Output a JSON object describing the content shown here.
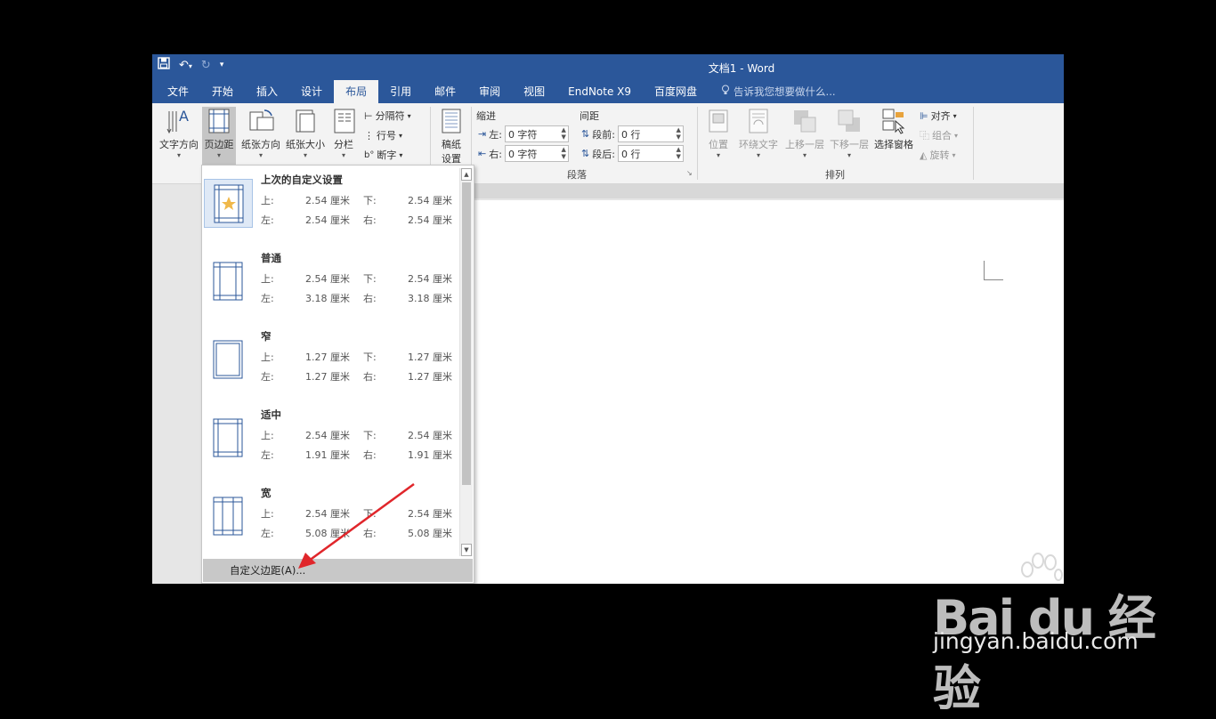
{
  "window": {
    "title": "文档1 - Word"
  },
  "tabs": [
    {
      "label": "文件"
    },
    {
      "label": "开始"
    },
    {
      "label": "插入"
    },
    {
      "label": "设计"
    },
    {
      "label": "布局",
      "active": true
    },
    {
      "label": "引用"
    },
    {
      "label": "邮件"
    },
    {
      "label": "审阅"
    },
    {
      "label": "视图"
    },
    {
      "label": "EndNote X9"
    },
    {
      "label": "百度网盘"
    }
  ],
  "tell_me": "告诉我您想要做什么...",
  "ribbon": {
    "text_direction": "文字方向",
    "margins": "页边距",
    "orientation": "纸张方向",
    "size": "纸张大小",
    "columns": "分栏",
    "breaks": "分隔符",
    "line_numbers": "行号",
    "hyphenation": "断字",
    "manuscript": "稿纸",
    "manuscript2": "设置",
    "indent_label": "缩进",
    "spacing_label": "间距",
    "indent_left_label": "左:",
    "indent_left_value": "0 字符",
    "indent_right_label": "右:",
    "indent_right_value": "0 字符",
    "before_label": "段前:",
    "before_value": "0 行",
    "after_label": "段后:",
    "after_value": "0 行",
    "paragraph_group": "段落",
    "position": "位置",
    "wrap_text": "环绕文字",
    "bring_forward": "上移一层",
    "send_backward": "下移一层",
    "selection_pane": "选择窗格",
    "align": "对齐",
    "group": "组合",
    "rotate": "旋转",
    "arrange_group": "排列"
  },
  "margins_menu": {
    "items": [
      {
        "title": "上次的自定义设置",
        "top_label": "上:",
        "top": "2.54 厘米",
        "bottom_label": "下:",
        "bottom": "2.54 厘米",
        "left_label": "左:",
        "left": "2.54 厘米",
        "right_label": "右:",
        "right": "2.54 厘米"
      },
      {
        "title": "普通",
        "top_label": "上:",
        "top": "2.54 厘米",
        "bottom_label": "下:",
        "bottom": "2.54 厘米",
        "left_label": "左:",
        "left": "3.18 厘米",
        "right_label": "右:",
        "right": "3.18 厘米"
      },
      {
        "title": "窄",
        "top_label": "上:",
        "top": "1.27 厘米",
        "bottom_label": "下:",
        "bottom": "1.27 厘米",
        "left_label": "左:",
        "left": "1.27 厘米",
        "right_label": "右:",
        "right": "1.27 厘米"
      },
      {
        "title": "适中",
        "top_label": "上:",
        "top": "2.54 厘米",
        "bottom_label": "下:",
        "bottom": "2.54 厘米",
        "left_label": "左:",
        "left": "1.91 厘米",
        "right_label": "右:",
        "right": "1.91 厘米"
      },
      {
        "title": "宽",
        "top_label": "上:",
        "top": "2.54 厘米",
        "bottom_label": "下:",
        "bottom": "2.54 厘米",
        "left_label": "左:",
        "left": "5.08 厘米",
        "right_label": "右:",
        "right": "5.08 厘米"
      }
    ],
    "custom": "自定义边距(A)..."
  },
  "watermark": {
    "logo": "Bai du 经验",
    "url": "jingyan.baidu.com"
  },
  "colors": {
    "titlebar": "#2b579a",
    "annotation_arrow": "#e0262b"
  }
}
